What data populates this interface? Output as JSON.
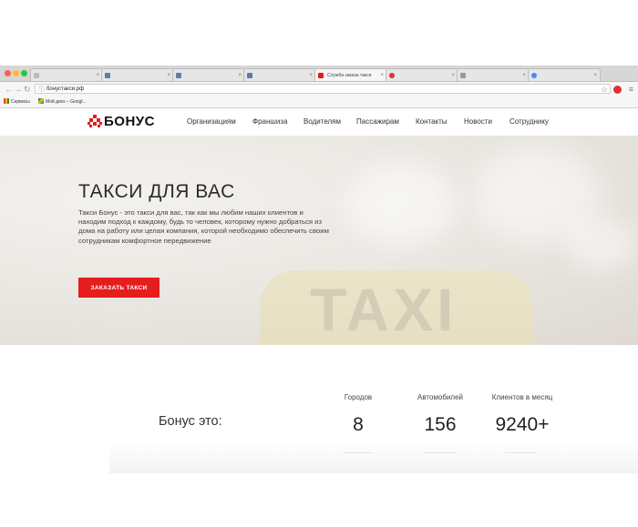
{
  "browser": {
    "tabs": [
      {
        "label": "",
        "active": false
      },
      {
        "label": "",
        "active": false
      },
      {
        "label": "",
        "active": false
      },
      {
        "label": "",
        "active": false
      },
      {
        "label": "Служба заказа такси",
        "active": true
      },
      {
        "label": "",
        "active": false
      },
      {
        "label": "",
        "active": false
      },
      {
        "label": "",
        "active": false
      }
    ],
    "address": "бонустакси.рф",
    "bookmarks": {
      "services": "Сервисы",
      "drive": "Мой диск – Googl..."
    }
  },
  "site": {
    "logo": "БОНУС",
    "nav": [
      "Организациям",
      "Франшиза",
      "Водителям",
      "Пассажирам",
      "Контакты",
      "Новости",
      "Сотруднику"
    ],
    "hero": {
      "title": "ТАКСИ ДЛЯ ВАС",
      "text": "Такси Бонус - это такси для вас, так как мы любим наших клиентов и находим подход к каждому, будь то человек, которому нужно добраться из дома на работу или целая компания, которой необходимо обеспечить своим сотрудникам комфортное передвижение",
      "button": "ЗАКАЗАТЬ ТАКСИ",
      "background_word": "TAXI"
    },
    "stats": {
      "label": "Бонус это:",
      "items": [
        {
          "title": "Городов",
          "value": "8"
        },
        {
          "title": "Автомобилей",
          "value": "156"
        },
        {
          "title": "Клиентов в месяц",
          "value": "9240+"
        }
      ]
    }
  },
  "colors": {
    "accent": "#e51d1d",
    "text": "#333333",
    "hero_bg": "#ebe8e3"
  }
}
